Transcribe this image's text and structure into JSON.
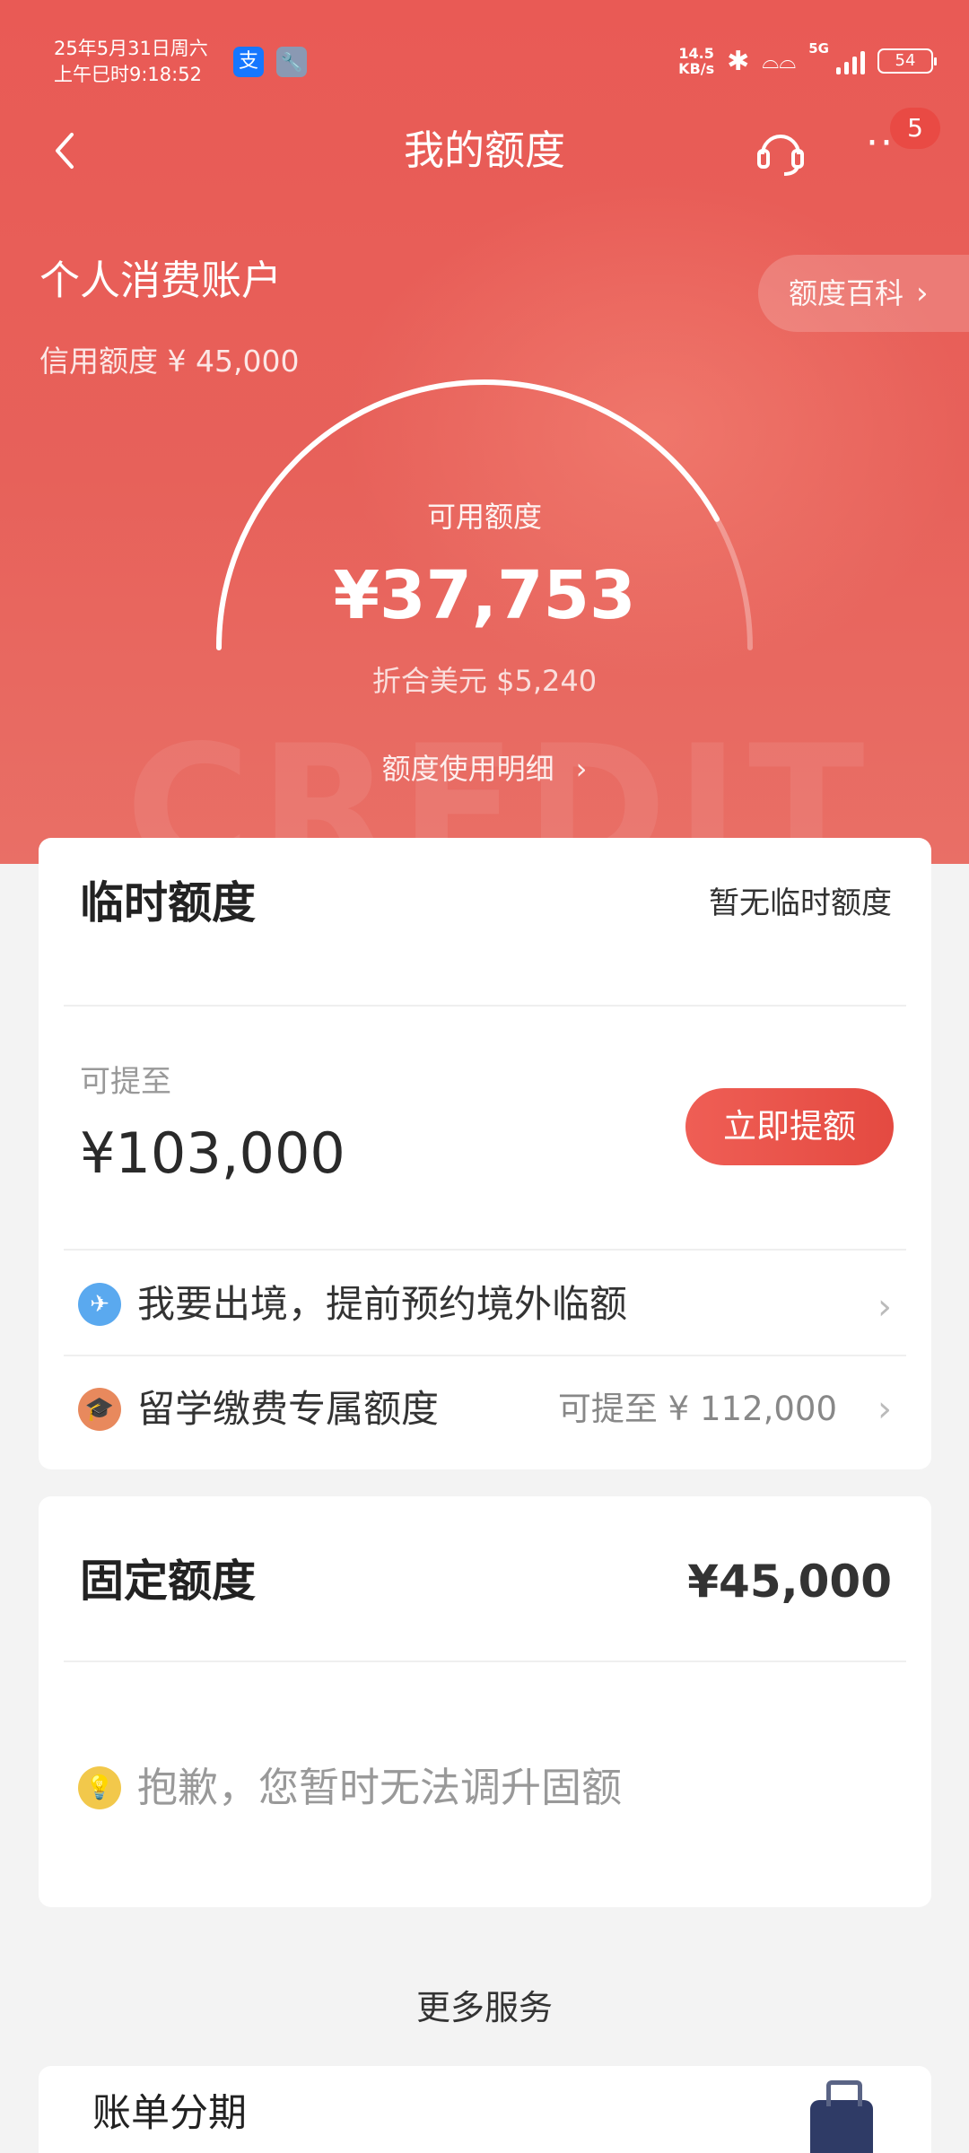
{
  "status_bar": {
    "date": "25年5月31日周六",
    "time": "上午巳时9:18:52",
    "app_icons": [
      "alipay-icon",
      "wrench-icon"
    ],
    "alipay_glyph": "支",
    "net_speed_value": "14.5",
    "net_speed_unit": "KB/s",
    "network": "5G",
    "battery": "54"
  },
  "nav": {
    "title": "我的额度",
    "badge": "5"
  },
  "account": {
    "title": "个人消费账户",
    "credit_limit": "信用额度 ¥ 45,000",
    "wiki_label": "额度百科"
  },
  "gauge": {
    "label": "可用额度",
    "amount": "¥37,753",
    "usd": "折合美元 $5,240",
    "detail_link": "额度使用明细",
    "available_fraction": 0.839
  },
  "temp_quota": {
    "title": "临时额度",
    "status": "暂无临时额度",
    "can_raise_label": "可提至",
    "can_raise_amount": "¥103,000",
    "raise_button": "立即提额",
    "rows": [
      {
        "text": "我要出境，提前预约境外临额",
        "sub": ""
      },
      {
        "text": "留学缴费专属额度",
        "sub": "可提至 ¥ 112,000"
      }
    ]
  },
  "fixed_quota": {
    "title": "固定额度",
    "amount": "¥45,000",
    "tip": "抱歉，您暂时无法调升固额"
  },
  "more_services": {
    "title": "更多服务",
    "first_item": "账单分期"
  },
  "colors": {
    "hero": "#e95a55",
    "button": "#e44a41",
    "page_bg": "#f3f3f3"
  }
}
